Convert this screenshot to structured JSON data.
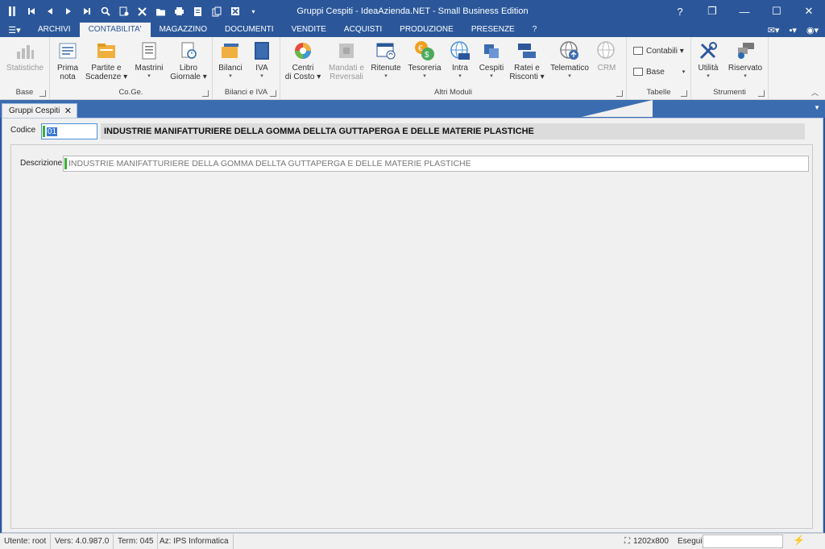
{
  "window": {
    "title": "Gruppi Cespiti - IdeaAzienda.NET - Small Business Edition",
    "help": "?",
    "restore": "❐",
    "minimize": "—",
    "maximize": "☐",
    "close": "✕"
  },
  "quick_access": [
    "first-icon",
    "prev-icon",
    "next-icon",
    "last-icon",
    "search-icon",
    "new-icon",
    "delete-icon",
    "folder-icon",
    "print-icon",
    "document-icon",
    "copy-icon",
    "excel-icon",
    "dropdown-icon"
  ],
  "menu": {
    "app_menu": "☰▾",
    "tabs": [
      "ARCHIVI",
      "CONTABILITA'",
      "MAGAZZINO",
      "DOCUMENTI",
      "VENDITE",
      "ACQUISTI",
      "PRODUZIONE",
      "PRESENZE",
      "?"
    ],
    "active": "CONTABILITA'",
    "mail": "✉▾",
    "settings": "▪▾",
    "user": "◉▾"
  },
  "ribbon": {
    "groups": {
      "base": "Base",
      "coge": "Co.Ge.",
      "bilanci_iva": "Bilanci e IVA",
      "altri_moduli": "Altri Moduli",
      "tabelle": "Tabelle",
      "strumenti": "Strumenti"
    },
    "buttons": {
      "statistiche": "Statistiche",
      "prima_nota_1": "Prima",
      "prima_nota_2": "nota",
      "partite_1": "Partite e",
      "partite_2": "Scadenze ▾",
      "mastrini": "Mastrini",
      "libro_1": "Libro",
      "libro_2": "Giornale ▾",
      "bilanci": "Bilanci",
      "iva": "IVA",
      "centri_1": "Centri",
      "centri_2": "di Costo ▾",
      "mandati_1": "Mandati e",
      "mandati_2": "Reversali",
      "ritenute": "Ritenute",
      "tesoreria": "Tesoreria",
      "intra": "Intra",
      "cespiti": "Cespiti",
      "ratei_1": "Ratei e",
      "ratei_2": "Risconti ▾",
      "telematico": "Telematico",
      "crm": "CRM",
      "contabili": "Contabili ▾",
      "base_small": "Base",
      "utilita": "Utilità",
      "riservato": "Riservato"
    },
    "arrow": "▾"
  },
  "doc_tab": {
    "label": "Gruppi Cespiti",
    "close": "✕"
  },
  "form": {
    "codice_label": "Codice",
    "codice_value": "01",
    "codice_description": "INDUSTRIE MANIFATTURIERE DELLA GOMMA DELLTA GUTTAPERGA E DELLE MATERIE PLASTICHE",
    "descrizione_label": "Descrizione",
    "descrizione_value": "INDUSTRIE MANIFATTURIERE DELLA GOMMA DELLTA GUTTAPERGA E DELLE MATERIE PLASTICHE"
  },
  "status": {
    "utente": "Utente: root",
    "versione": "Vers: 4.0.987.0",
    "terminale": "Term: 045",
    "azienda": "Az: IPS Informatica",
    "resolution": "1202x800",
    "esegui": "Esegui"
  },
  "colors": {
    "title_bar": "#2b579a",
    "accent": "#3c6cb0",
    "ribbon_bg": "#f3f3f3",
    "field_marker": "#38b035"
  }
}
